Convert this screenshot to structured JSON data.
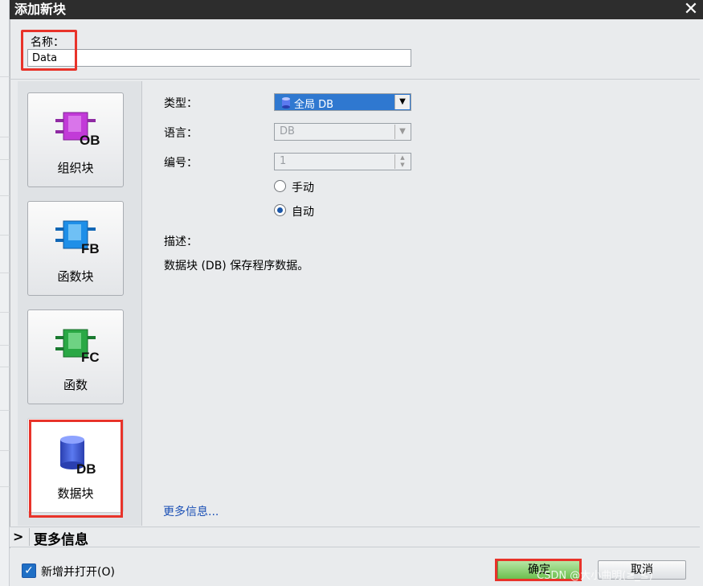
{
  "dialog": {
    "title": "添加新块"
  },
  "name_field": {
    "label": "名称：",
    "value": "Data"
  },
  "blocks": [
    {
      "icon": "ob-block-icon",
      "tag": "OB",
      "label": "组织块",
      "color": "#c23bd8"
    },
    {
      "icon": "fb-block-icon",
      "tag": "FB",
      "label": "函数块",
      "color": "#1f8fe8"
    },
    {
      "icon": "fc-block-icon",
      "tag": "FC",
      "label": "函数",
      "color": "#2aa845"
    },
    {
      "icon": "db-block-icon",
      "tag": "DB",
      "label": "数据块",
      "color": "#3657d6",
      "selected": true
    }
  ],
  "properties": {
    "type_label": "类型：",
    "type_value": "全局 DB",
    "language_label": "语言：",
    "language_value": "DB",
    "number_label": "编号：",
    "number_value": "1",
    "manual_label": "手动",
    "auto_label": "自动",
    "selected_mode": "auto",
    "description_label": "描述：",
    "description_text": "数据块 (DB) 保存程序数据。",
    "more_info_link": "更多信息..."
  },
  "info_section": {
    "title": "更多信息"
  },
  "footer": {
    "checkbox_label": "新增并打开(O)",
    "checkbox_checked": true,
    "ok_label": "确定",
    "cancel_label": "取消",
    "watermark": "CSDN @大小曲明(≥_≤)"
  },
  "colors": {
    "accent": "#2f78d0",
    "highlight": "#e8332a",
    "ok_button": "#6cbf4f"
  }
}
